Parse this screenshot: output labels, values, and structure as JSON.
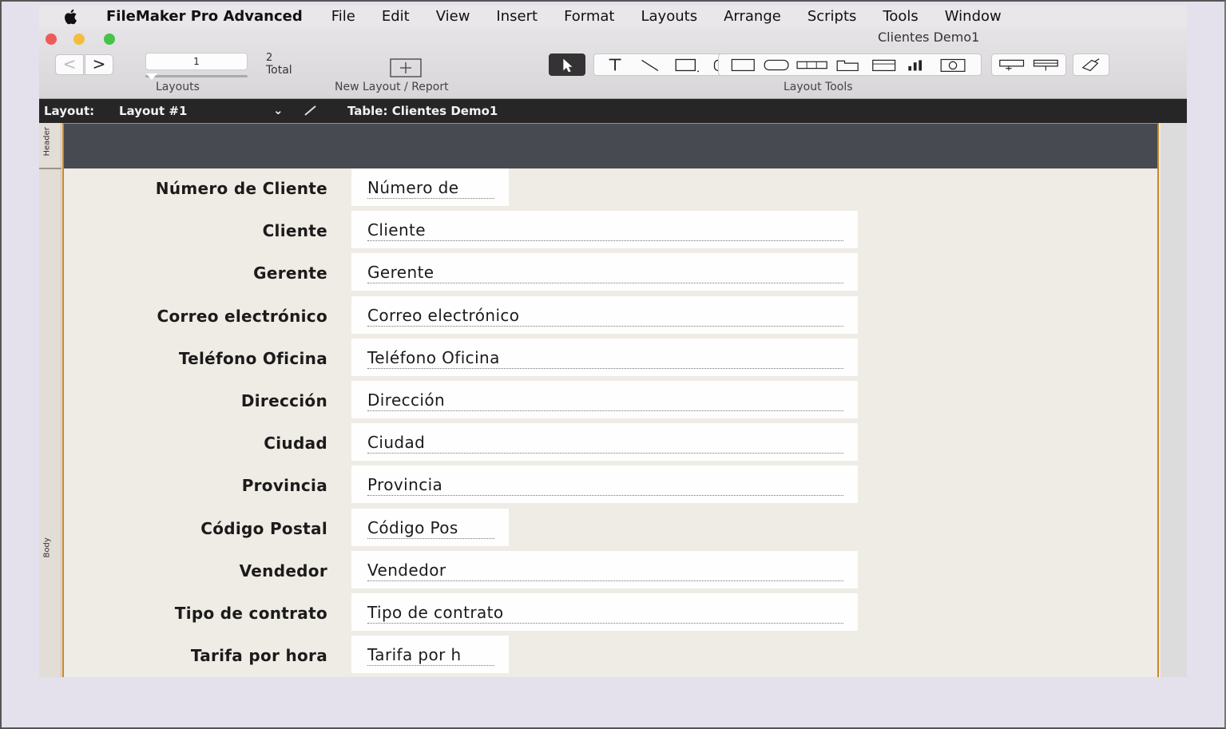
{
  "menubar": {
    "app_name": "FileMaker Pro Advanced",
    "items": [
      "File",
      "Edit",
      "View",
      "Insert",
      "Format",
      "Layouts",
      "Arrange",
      "Scripts",
      "Tools",
      "Window"
    ]
  },
  "window": {
    "title": "Clientes Demo1"
  },
  "toolbar": {
    "nav_back": "<",
    "nav_forward": ">",
    "current_record": "1",
    "total_count": "2",
    "total_label": "Total",
    "layouts_label": "Layouts",
    "new_layout_label": "New Layout / Report",
    "layout_tools_label": "Layout Tools",
    "tools": [
      "pointer-icon",
      "text-icon",
      "line-icon",
      "rectangle-icon",
      "field-icon",
      "button-icon",
      "button-bar-icon",
      "tab-control-icon",
      "slide-control-icon",
      "chart-icon",
      "web-viewer-icon",
      "popover-button-icon",
      "portal-icon",
      "format-painter-icon"
    ]
  },
  "layout_bar": {
    "layout_label": "Layout:",
    "layout_name": "Layout #1",
    "table_label": "Table: Clientes Demo1"
  },
  "parts": {
    "header": "Header",
    "body": "Body"
  },
  "fields": [
    {
      "label": "Número de Cliente",
      "value": "Número de",
      "size": "short"
    },
    {
      "label": "Cliente",
      "value": "Cliente",
      "size": "long"
    },
    {
      "label": "Gerente",
      "value": "Gerente",
      "size": "long"
    },
    {
      "label": "Correo electrónico",
      "value": "Correo electrónico",
      "size": "long"
    },
    {
      "label": "Teléfono Oficina",
      "value": "Teléfono Oficina",
      "size": "long"
    },
    {
      "label": "Dirección",
      "value": "Dirección",
      "size": "long"
    },
    {
      "label": "Ciudad",
      "value": "Ciudad",
      "size": "long"
    },
    {
      "label": "Provincia",
      "value": "Provincia",
      "size": "long"
    },
    {
      "label": "Código Postal",
      "value": "Código Pos",
      "size": "short"
    },
    {
      "label": "Vendedor",
      "value": "Vendedor",
      "size": "long"
    },
    {
      "label": "Tipo de contrato",
      "value": "Tipo de contrato",
      "size": "long"
    },
    {
      "label": "Tarifa por hora",
      "value": "Tarifa por h",
      "size": "short"
    }
  ],
  "colors": {
    "header_part": "#474a50",
    "part_border": "#c8872c",
    "layout_bar": "#262626"
  }
}
